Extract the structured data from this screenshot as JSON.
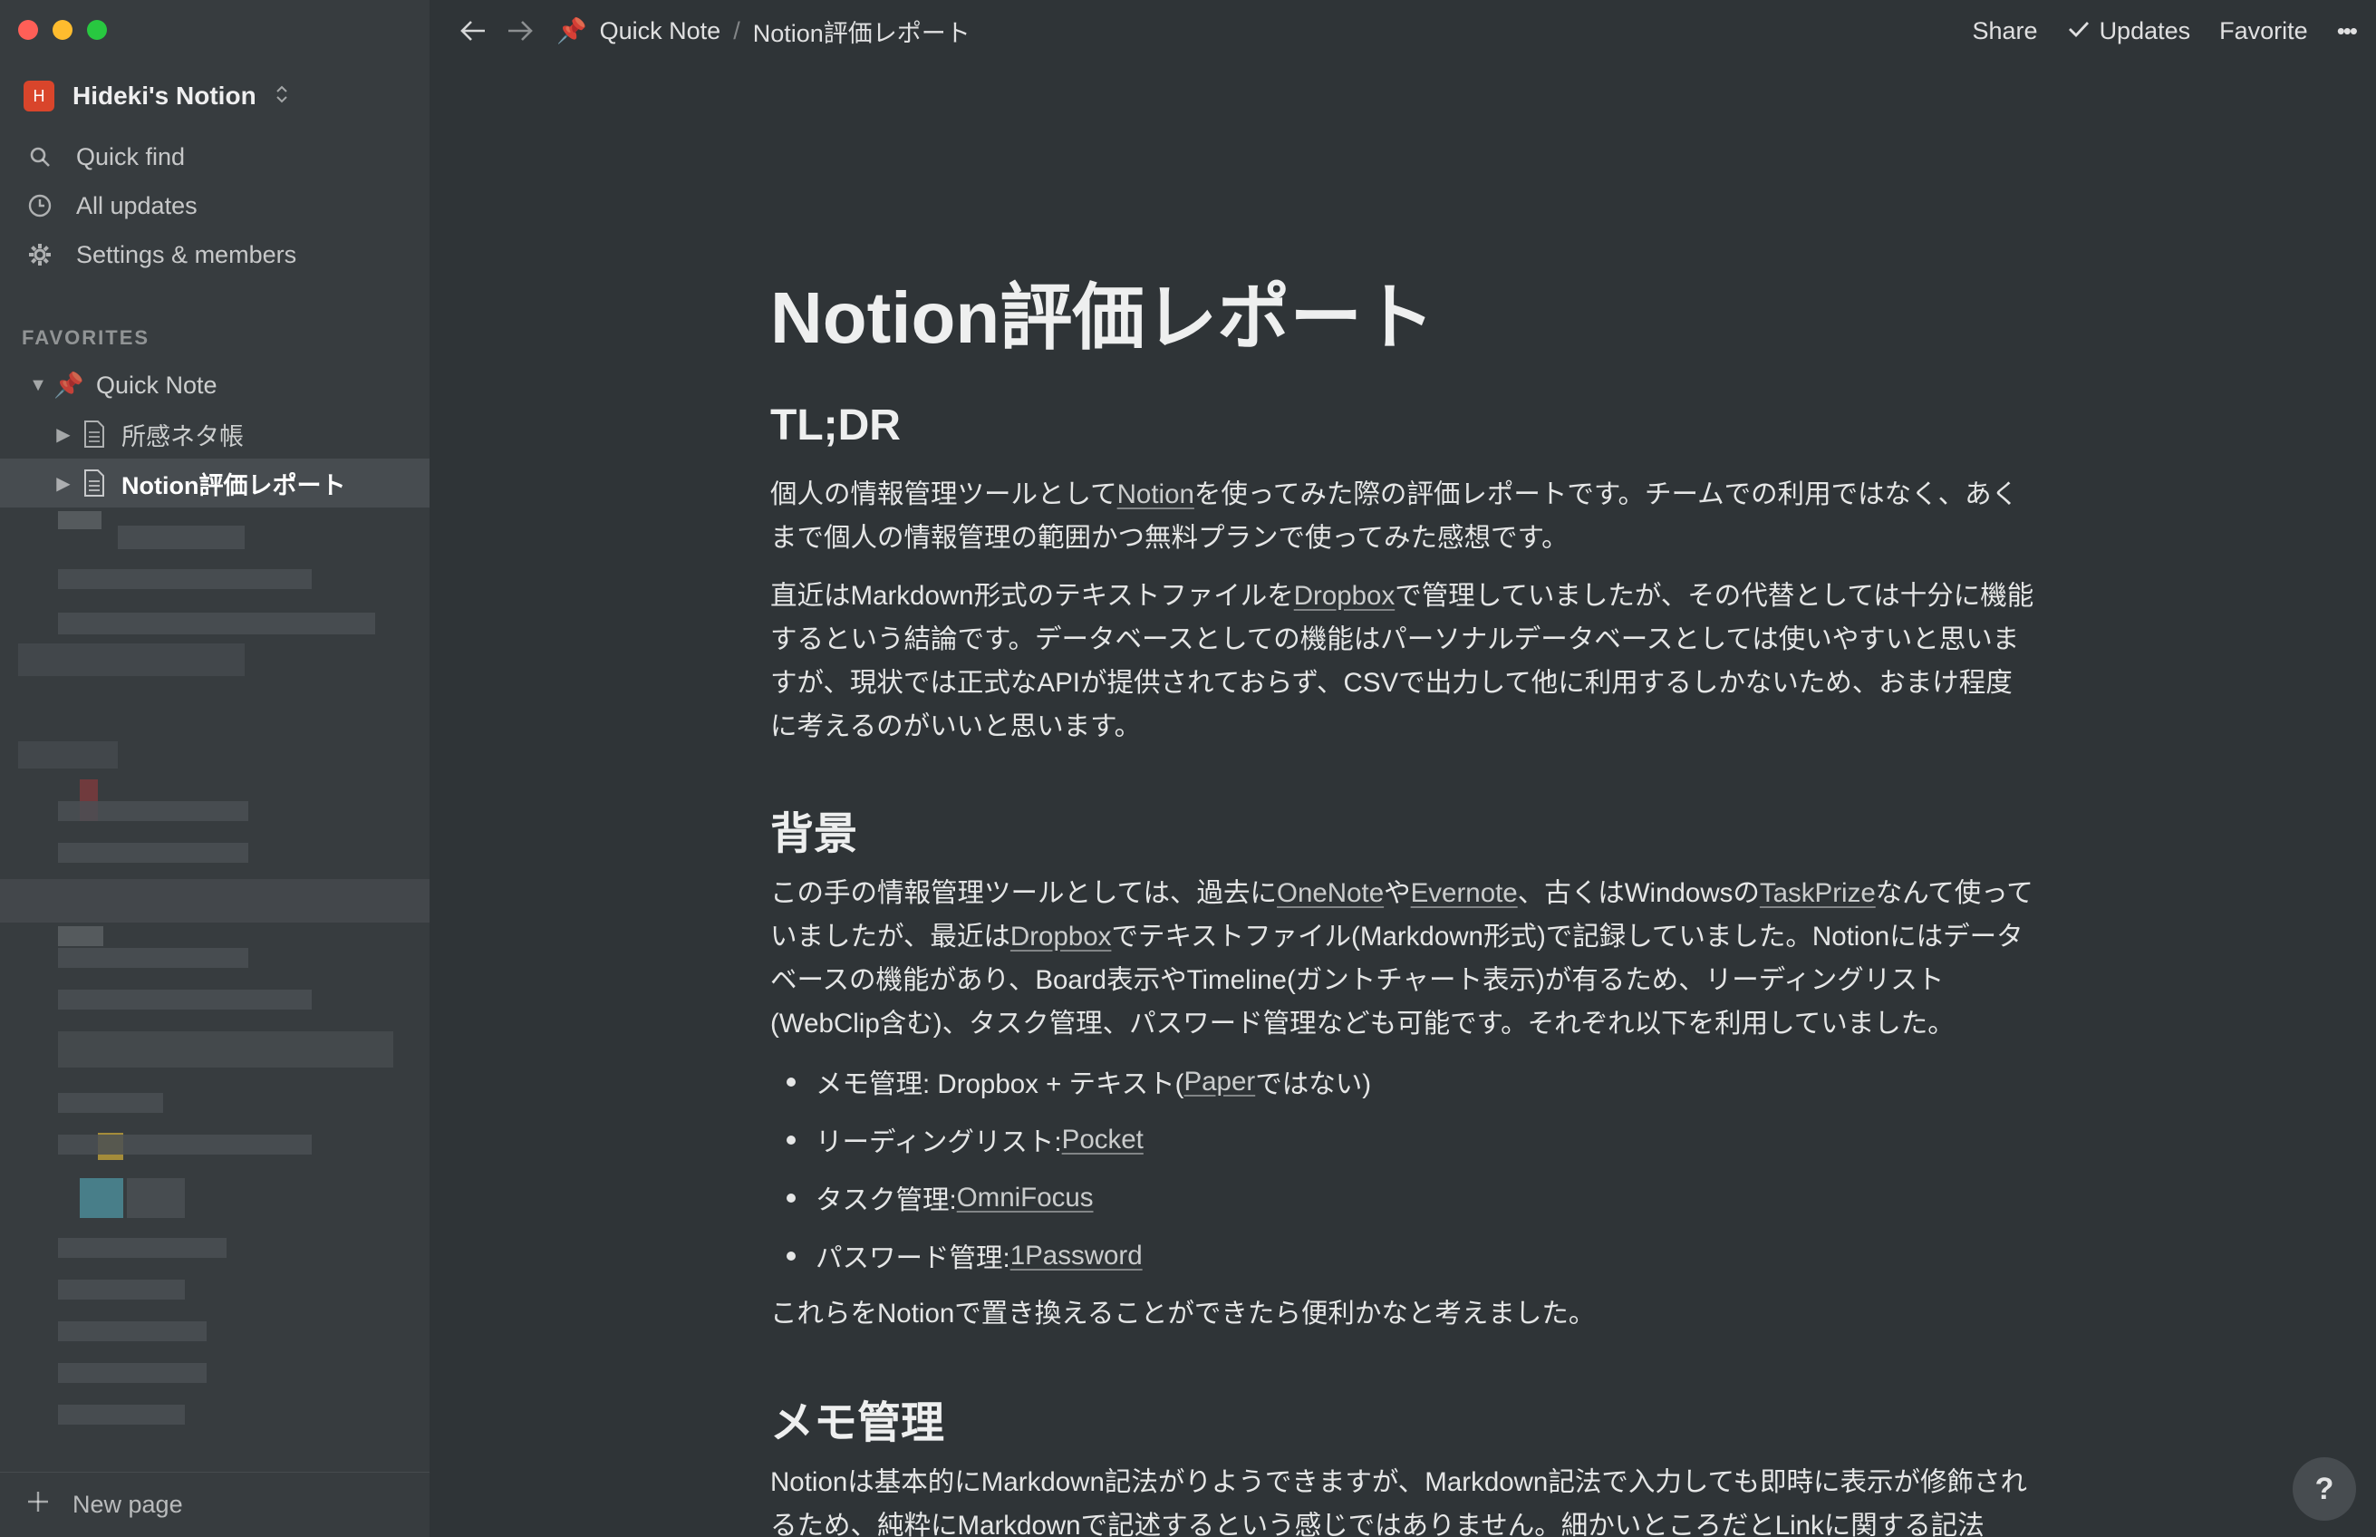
{
  "sidebar": {
    "workspace": {
      "initial": "H",
      "name": "Hideki's Notion"
    },
    "nav": [
      {
        "label": "Quick find",
        "icon": "search-icon"
      },
      {
        "label": "All updates",
        "icon": "clock-icon"
      },
      {
        "label": "Settings & members",
        "icon": "gear-icon"
      }
    ],
    "favorites_header": "FAVORITES",
    "tree": [
      {
        "emoji": "📌",
        "label": "Quick Note",
        "caret": "▼"
      },
      {
        "label": "所感ネタ帳",
        "caret": "▶"
      },
      {
        "label": "Notion評価レポート",
        "caret": "▶"
      }
    ],
    "new_page": "New page"
  },
  "topbar": {
    "breadcrumb": {
      "emoji": "📌",
      "parent": "Quick Note",
      "sep": "/",
      "current": "Notion評価レポート"
    },
    "share": "Share",
    "updates": "Updates",
    "favorite": "Favorite",
    "more": "•••"
  },
  "page": {
    "title": "Notion評価レポート",
    "h_tldr": "TL;DR",
    "tldr_p1": {
      "a": "個人の情報管理ツールとして",
      "link": "Notion",
      "b": "を使ってみた際の評価レポートです。チームでの利用ではなく、あくまで個人の情報管理の範囲かつ無料プランで使ってみた感想です。"
    },
    "tldr_p2": {
      "a": "直近はMarkdown形式のテキストファイルを",
      "link": "Dropbox",
      "b": "で管理していましたが、その代替としては十分に機能するという結論です。データベースとしての機能はパーソナルデータベースとしては使いやすいと思いますが、現状では正式なAPIが提供されておらず、CSVで出力して他に利用するしかないため、おまけ程度に考えるのがいいと思います。"
    },
    "h_bg": "背景",
    "bg_p": {
      "a": "この手の情報管理ツールとしては、過去に",
      "l1": "OneNote",
      "b": "や",
      "l2": "Evernote",
      "c": "、古くはWindowsの",
      "l3": "TaskPrize",
      "d": "なんて使っていましたが、最近は",
      "l4": "Dropbox",
      "e": "でテキストファイル(Markdown形式)で記録していました。Notionにはデータベースの機能があり、Board表示やTimeline(ガントチャート表示)が有るため、リーディングリスト(WebClip含む)、タスク管理、パスワード管理なども可能です。それぞれ以下を利用していました。"
    },
    "bullets": [
      {
        "text": "メモ管理: Dropbox + テキスト(",
        "link": "Paper",
        "after": "ではない)"
      },
      {
        "text": "リーディングリスト: ",
        "link": "Pocket",
        "after": ""
      },
      {
        "text": "タスク管理: ",
        "link": "OmniFocus",
        "after": ""
      },
      {
        "text": "パスワード管理: ",
        "link": "1Password",
        "after": ""
      }
    ],
    "bg_conclusion": "これらをNotionで置き換えることができたら便利かなと考えました。",
    "h_memo": "メモ管理",
    "memo_p": "Notionは基本的にMarkdown記法がりようできますが、Markdown記法で入力しても即時に表示が修飾されるため、純粋にMarkdownで記述するという感じではありません。細かいところだとLinkに関する記法"
  },
  "help": "?"
}
